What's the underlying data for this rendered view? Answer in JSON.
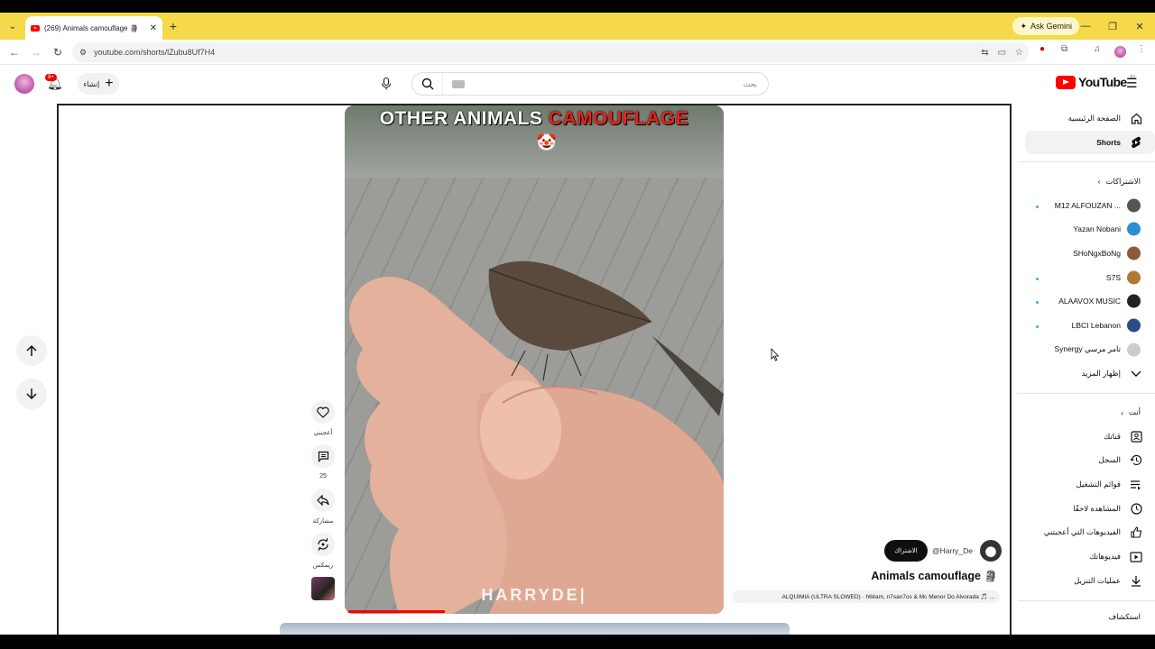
{
  "browser": {
    "tab_title": "(269) Animals camouflage 🗿",
    "url": "youtube.com/shorts/lZubu8Uf7H4",
    "gemini_label": "Ask Gemini"
  },
  "header": {
    "notif_count": "9+",
    "create_label": "إنشاء",
    "search_placeholder": "بحث",
    "logo_text": "YouTube",
    "logo_country": "JO"
  },
  "video": {
    "caption_white": "OTHER ANIMALS",
    "caption_red": "CAMOUFLAGE",
    "watermark": "HARRYDE|",
    "progress": 0.26
  },
  "actions": [
    {
      "icon": "heart-icon",
      "label": "أعجبني"
    },
    {
      "icon": "comment-icon",
      "label": "25"
    },
    {
      "icon": "share-icon",
      "label": "مشاركة"
    },
    {
      "icon": "remix-icon",
      "label": "ريمكس"
    }
  ],
  "channel": {
    "subscribe_label": "الاشتراك",
    "handle": "@Harry_De",
    "title": "Animals camouflage 🗿",
    "music": "ALQUIMIA (ULTRA SLOWED) · h6itam, n7san7os & Mc Menor Do Alvorada 🎵 ..."
  },
  "sidebar": {
    "main": [
      {
        "label": "الصفحة الرئيسية",
        "icon": "home-icon",
        "active": false
      },
      {
        "label": "Shorts",
        "icon": "shorts-icon",
        "active": true
      }
    ],
    "subs_heading": "الاشتراكات",
    "subscriptions": [
      {
        "label": "M12 ALFOUZAN ...",
        "dot": true,
        "color": "#555"
      },
      {
        "label": "Yazan Nobani",
        "dot": false,
        "color": "#2a8fd0"
      },
      {
        "label": "SHoNgxBoNg",
        "dot": false,
        "color": "#8a5a3a"
      },
      {
        "label": "S7S",
        "dot": true,
        "color": "#b07a30"
      },
      {
        "label": "ALAAVOX MUSIC",
        "dot": true,
        "color": "#222"
      },
      {
        "label": "LBCI Lebanon",
        "dot": true,
        "color": "#2b4b8a"
      },
      {
        "label": "Synergy تامر مرسي",
        "dot": false,
        "color": "#ccc"
      }
    ],
    "show_more": "إظهار المزيد",
    "you_heading": "أنت",
    "you_items": [
      {
        "label": "قناتك",
        "icon": "channel-icon"
      },
      {
        "label": "السجل",
        "icon": "history-icon"
      },
      {
        "label": "قوائم التشغيل",
        "icon": "playlist-icon"
      },
      {
        "label": "المشاهدة لاحقًا",
        "icon": "clock-icon"
      },
      {
        "label": "الفيديوهات التي أعجبتني",
        "icon": "thumbs-up-icon"
      },
      {
        "label": "فيديوهاتك",
        "icon": "video-icon"
      },
      {
        "label": "عمليات التنزيل",
        "icon": "download-icon"
      }
    ],
    "explore_heading": "استكشاف"
  }
}
